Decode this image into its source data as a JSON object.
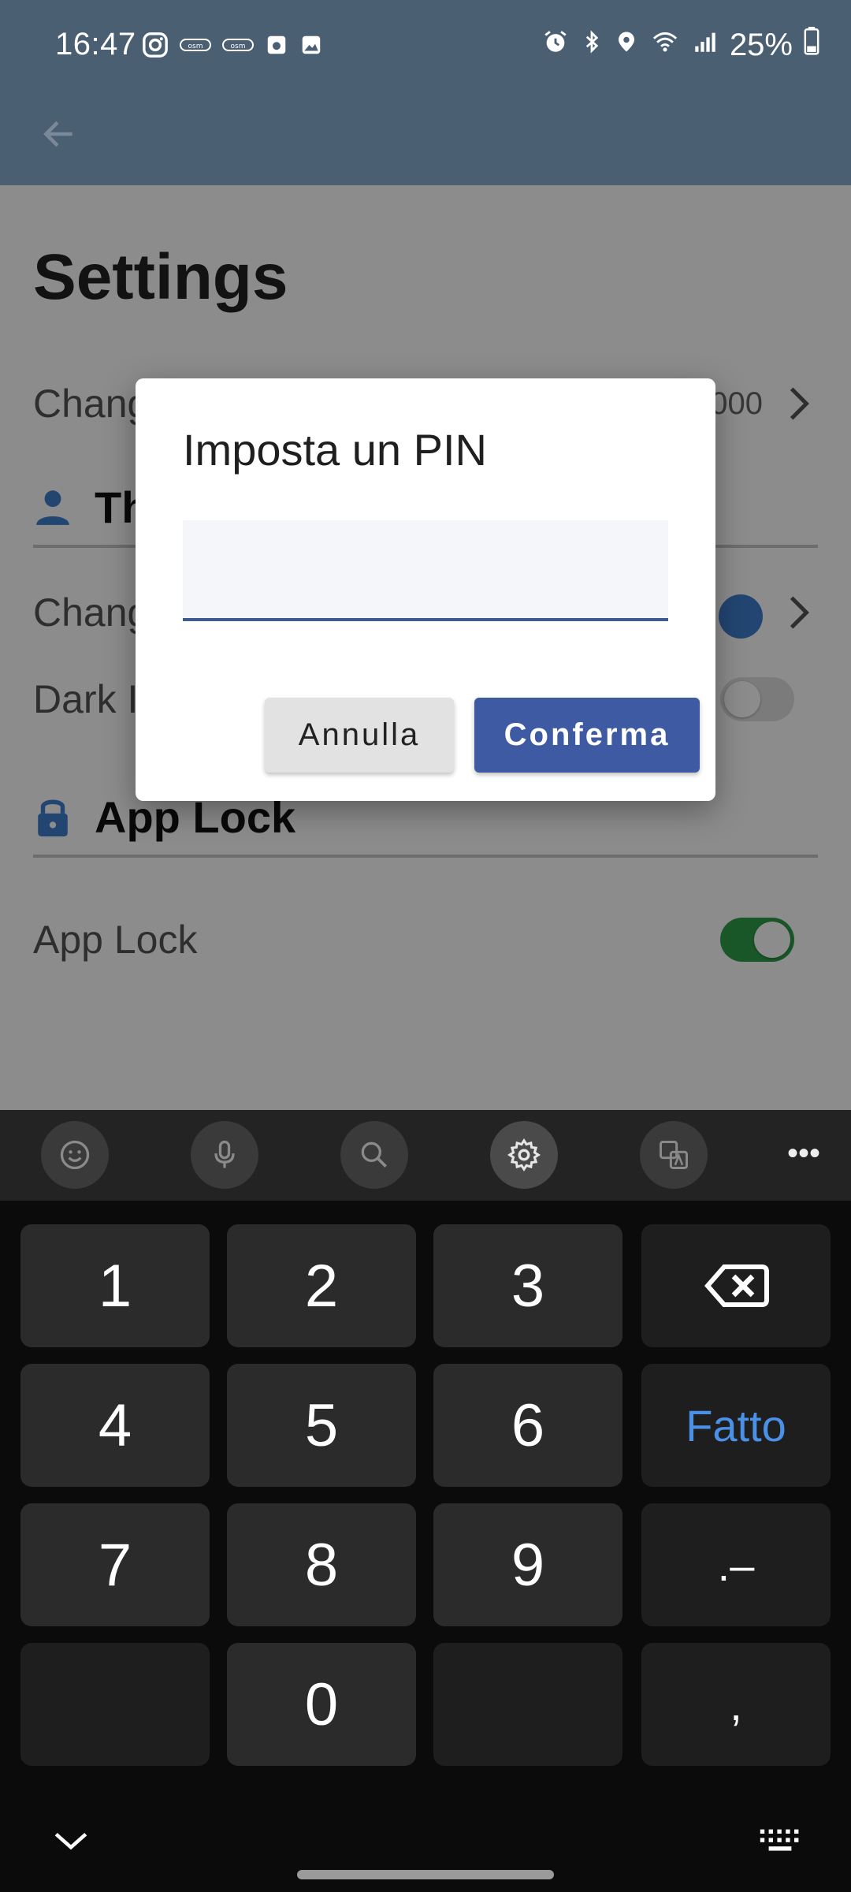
{
  "status_bar": {
    "time": "16:47",
    "battery": "25%",
    "icons": [
      "instagram-icon",
      "osm-icon",
      "osm-icon",
      "camera-roll-icon",
      "image-icon",
      "alarm-icon",
      "bluetooth-icon",
      "location-icon",
      "wifi-icon",
      "signal-icon",
      "battery-icon"
    ]
  },
  "app_bar": {
    "back_icon": "arrow-left-icon"
  },
  "page": {
    "title": "Settings",
    "row_change_1": {
      "label": "Chang",
      "value": "000"
    },
    "section_theme": {
      "label": "Th",
      "icon": "person-icon",
      "icon_color": "#3f7fd0"
    },
    "row_change_2": {
      "label": "Chang",
      "swatch_color": "#3f7fd0"
    },
    "row_dark": {
      "label": "Dark I",
      "enabled": false
    },
    "section_lock": {
      "label": "App Lock",
      "icon": "lock-icon",
      "icon_color": "#3f7fd0"
    },
    "row_app_lock": {
      "label": "App Lock",
      "enabled": true
    }
  },
  "dialog": {
    "title": "Imposta un PIN",
    "pin_value": "",
    "cancel_label": "Annulla",
    "confirm_label": "Conferma"
  },
  "keyboard": {
    "toolbar": [
      "emoji-icon",
      "microphone-icon",
      "search-icon",
      "settings-icon",
      "translate-icon",
      "more-icon"
    ],
    "more_label": "•••",
    "keys": {
      "k1": "1",
      "k2": "2",
      "k3": "3",
      "k4": "4",
      "k5": "5",
      "k6": "6",
      "done": "Fatto",
      "k7": "7",
      "k8": "8",
      "k9": "9",
      "punct": ".–",
      "k0": "0",
      "comma": ","
    },
    "icons": {
      "backspace": "backspace-icon",
      "hide": "chevron-down-icon",
      "switch": "keyboard-icon"
    }
  },
  "colors": {
    "primary": "#3d5aa2",
    "appbar": "#4b5f73",
    "toggle_on": "#2e9e4a",
    "accent": "#4a90e6"
  }
}
